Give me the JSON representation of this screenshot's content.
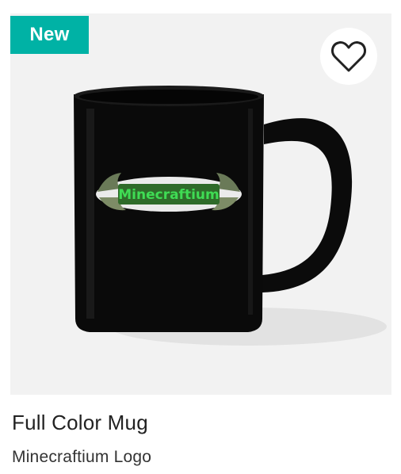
{
  "product": {
    "badge": "New",
    "title": "Full Color Mug",
    "subtitle": "Minecraftium Logo",
    "logo_text": "Minecraftium",
    "favorite_icon": "heart-outline-icon"
  },
  "colors": {
    "badge_bg": "#00b2a5",
    "image_bg": "#f2f2f2",
    "mug": "#0a0a0a",
    "logo_green": "#3fdc54"
  }
}
